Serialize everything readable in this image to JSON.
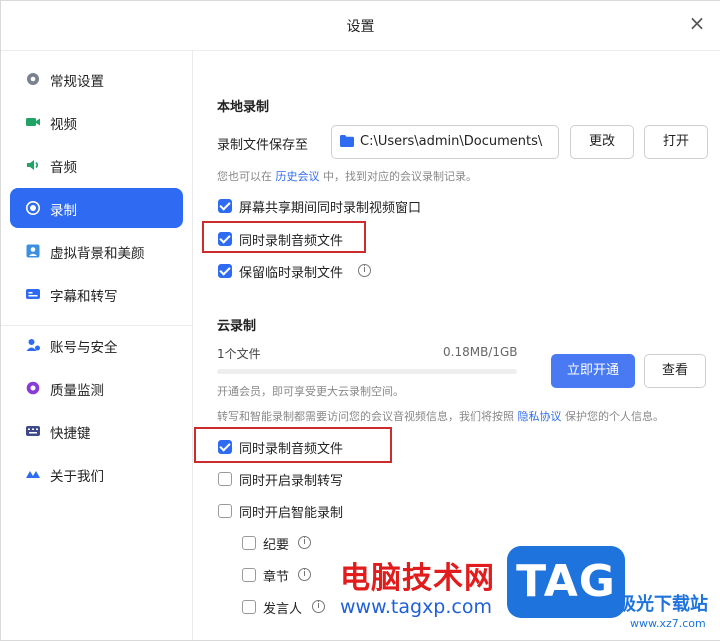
{
  "window": {
    "title": "设置",
    "close_glyph": "×"
  },
  "sidebar": {
    "items": [
      {
        "label": "常规设置",
        "icon": "gear-icon"
      },
      {
        "label": "视频",
        "icon": "camera-icon"
      },
      {
        "label": "音频",
        "icon": "speaker-icon"
      },
      {
        "label": "录制",
        "icon": "record-icon",
        "active": true
      },
      {
        "label": "虚拟背景和美颜",
        "icon": "portrait-icon"
      },
      {
        "label": "字幕和转写",
        "icon": "captions-icon"
      },
      {
        "label": "账号与安全",
        "icon": "account-icon"
      },
      {
        "label": "质量监测",
        "icon": "monitor-icon"
      },
      {
        "label": "快捷键",
        "icon": "keyboard-icon"
      },
      {
        "label": "关于我们",
        "icon": "about-icon"
      }
    ]
  },
  "local": {
    "heading": "本地录制",
    "save_label": "录制文件保存至",
    "path_value": "C:\\Users\\admin\\Documents\\",
    "change_button": "更改",
    "open_button": "打开",
    "hint_before": "您也可以在",
    "hint_link": "历史会议",
    "hint_after": "中，找到对应的会议录制记录。",
    "options": [
      {
        "label": "屏幕共享期间同时录制视频窗口",
        "checked": true
      },
      {
        "label": "同时录制音频文件",
        "checked": true
      },
      {
        "label": "保留临时录制文件",
        "checked": true
      }
    ],
    "info_glyph": "i"
  },
  "cloud": {
    "heading": "云录制",
    "file_count": "1个文件",
    "usage": "0.18MB/1GB",
    "usage_fraction": 0.0002,
    "open_button": "立即开通",
    "view_button": "查看",
    "member_hint": "开通会员，即可享受更大云录制空间。",
    "privacy_before": "转写和智能录制都需要访问您的会议音视频信息，我们将按照",
    "privacy_link": "隐私协议",
    "privacy_after": "保护您的个人信息。",
    "options": [
      {
        "label": "同时录制音频文件",
        "checked": true
      },
      {
        "label": "同时开启录制转写",
        "checked": false
      },
      {
        "label": "同时开启智能录制",
        "checked": false
      }
    ],
    "sub_options": [
      {
        "label": "纪要",
        "checked": false
      },
      {
        "label": "章节",
        "checked": false
      },
      {
        "label": "发言人",
        "checked": false
      }
    ]
  },
  "watermark": {
    "site_name": "电脑技术网",
    "site_url": "www.tagxp.com",
    "logo_text": "TAG",
    "corner_text": "极光下载站",
    "corner_url": "www.xz7.com"
  },
  "colors": {
    "accent": "#2f6bf2",
    "highlight_box": "#cc2c2c",
    "watermark_red": "#e21c1c",
    "watermark_blue": "#1f73dd"
  }
}
